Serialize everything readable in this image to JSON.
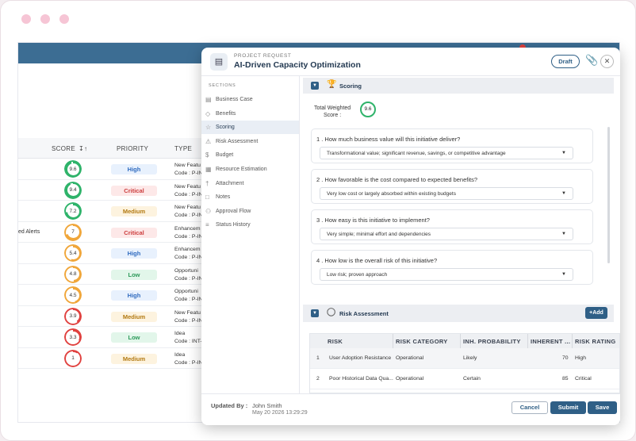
{
  "modal": {
    "kicker": "PROJECT REQUEST",
    "title": "AI-Driven Capacity Optimization",
    "status": "Draft"
  },
  "sidebar": {
    "label": "SECTIONS",
    "items": [
      {
        "label": "Business Case",
        "icon": "clipboard-icon"
      },
      {
        "label": "Benefits",
        "icon": "tag-icon"
      },
      {
        "label": "Scoring",
        "icon": "trophy-icon"
      },
      {
        "label": "Risk Assessment",
        "icon": "warning-icon"
      },
      {
        "label": "Budget",
        "icon": "dollar-icon"
      },
      {
        "label": "Resource Estimation",
        "icon": "grid-icon"
      },
      {
        "label": "Attachment",
        "icon": "paperclip-icon"
      },
      {
        "label": "Notes",
        "icon": "note-icon"
      },
      {
        "label": "Approval Flow",
        "icon": "people-icon"
      },
      {
        "label": "Status History",
        "icon": "list-icon"
      }
    ]
  },
  "scoring": {
    "header": "Scoring",
    "total_label_1": "Total Weighted",
    "total_label_2": "Score :",
    "total_value": "9.6",
    "questions": [
      {
        "q": "1 . How much business value will this initiative deliver?",
        "a": "Transformational value; significant revenue, savings, or competitive advantage"
      },
      {
        "q": "2 . How favorable is the cost compared to expected benefits?",
        "a": "Very low cost or largely absorbed within existing budgets"
      },
      {
        "q": "3 . How easy is this initiative to implement?",
        "a": "Very simple; minimal effort and dependencies"
      },
      {
        "q": "4 . How low is the overall risk of this initiative?",
        "a": "Low risk; proven approach"
      }
    ]
  },
  "risk": {
    "header": "Risk Assessment",
    "add_label": "+Add",
    "columns": [
      "RISK",
      "RISK CATEGORY",
      "INH. PROBABILITY",
      "INHERENT ...",
      "RISK RATING"
    ],
    "rows": [
      {
        "n": "1",
        "risk": "User Adoption Resistance",
        "category": "Operational",
        "prob": "Likely",
        "inherent": "70",
        "rating": "High"
      },
      {
        "n": "2",
        "risk": "Poor Historical Data Qua...",
        "category": "Operational",
        "prob": "Certain",
        "inherent": "85",
        "rating": "Critical"
      }
    ]
  },
  "footer": {
    "updated_label": "Updated By :",
    "updated_name": "John Smith",
    "updated_date": "May 20 2026 13:29:29",
    "cancel": "Cancel",
    "submit": "Submit",
    "save": "Save"
  },
  "background_table": {
    "headers": {
      "score": "SCORE",
      "sort": "↧↑",
      "priority": "PRIORITY",
      "type": "TYPE"
    },
    "rows": [
      {
        "side": "",
        "score": "9.6",
        "level": 0.96,
        "color": "#2fb36a",
        "priority": "High",
        "cls": "high",
        "type": "New Featu",
        "code": "Code :  P-IN"
      },
      {
        "side": "",
        "score": "9.4",
        "level": 0.94,
        "color": "#2fb36a",
        "priority": "Critical",
        "cls": "critical",
        "type": "New Featu",
        "code": "Code :  P-IN"
      },
      {
        "side": "",
        "score": "7.2",
        "level": 0.72,
        "color": "#2fb36a",
        "priority": "Medium",
        "cls": "medium",
        "type": "New Featu",
        "code": "Code :  P-IN"
      },
      {
        "side": "ed Alerts",
        "score": "7",
        "level": 0.7,
        "color": "#f0a63a",
        "priority": "Critical",
        "cls": "critical",
        "type": "Enhancem",
        "code": "Code :  P-IN"
      },
      {
        "side": "",
        "score": "5.4",
        "level": 0.54,
        "color": "#f0a63a",
        "priority": "High",
        "cls": "high",
        "type": "Enhancem",
        "code": "Code :  P-IN"
      },
      {
        "side": "",
        "score": "4.8",
        "level": 0.48,
        "color": "#f0a63a",
        "priority": "Low",
        "cls": "low",
        "type": "Opportuni",
        "code": "Code :  P-IN"
      },
      {
        "side": "",
        "score": "4.5",
        "level": 0.45,
        "color": "#f0a63a",
        "priority": "High",
        "cls": "high",
        "type": "Opportuni",
        "code": "Code :  P-IN"
      },
      {
        "side": "",
        "score": "3.9",
        "level": 0.39,
        "color": "#e0413f",
        "priority": "Medium",
        "cls": "medium",
        "type": "New Featu",
        "code": "Code :  P-IN"
      },
      {
        "side": "",
        "score": "3.3",
        "level": 0.33,
        "color": "#e0413f",
        "priority": "Low",
        "cls": "low",
        "type": "Idea",
        "code": "Code :  INT-"
      },
      {
        "side": "",
        "score": "1",
        "level": 0.1,
        "color": "#e0413f",
        "priority": "Medium",
        "cls": "medium",
        "type": "Idea",
        "code": "Code :  P-IN"
      }
    ]
  }
}
